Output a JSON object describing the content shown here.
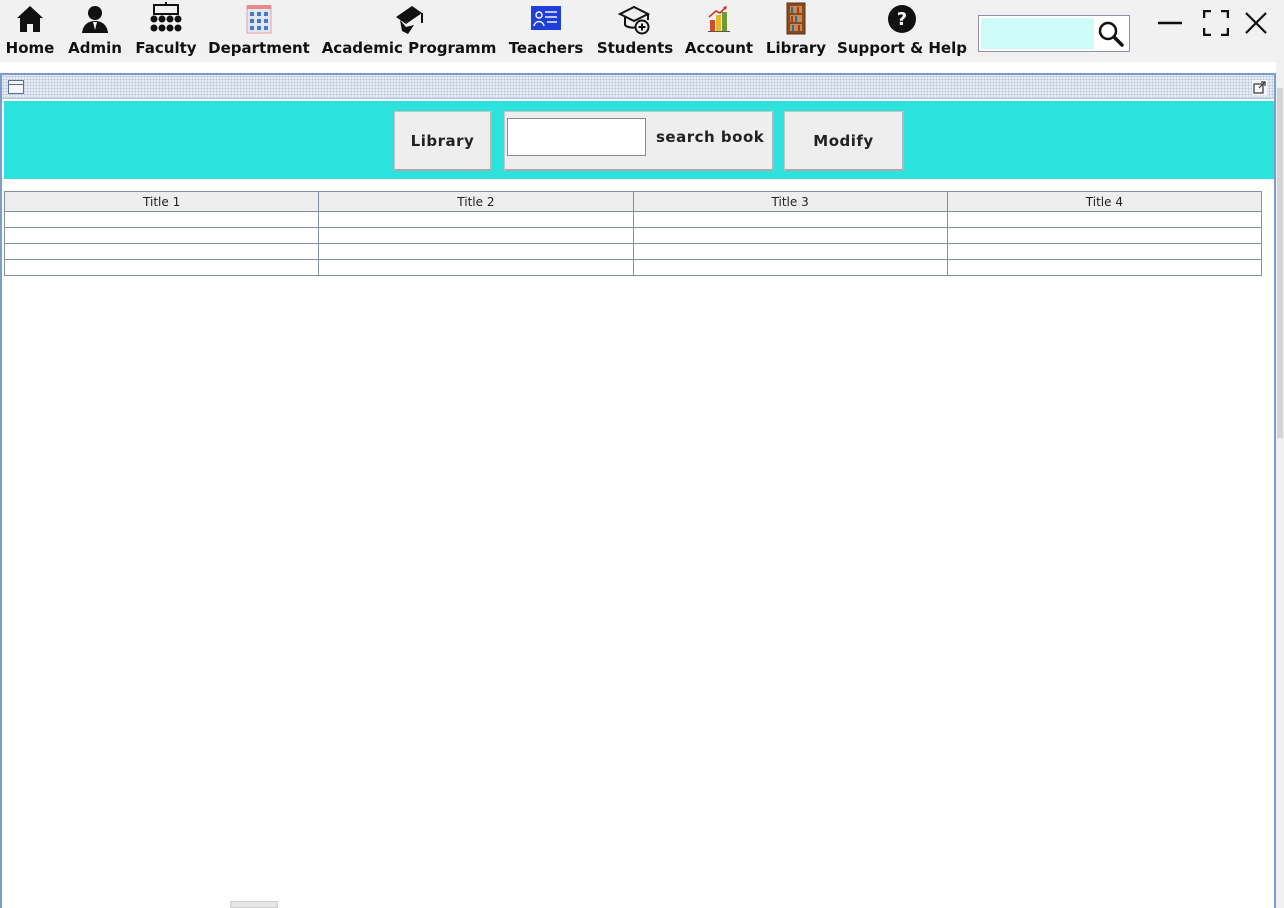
{
  "nav": {
    "items": [
      {
        "label": "Home",
        "icon": "home-icon"
      },
      {
        "label": "Admin",
        "icon": "admin-user-icon"
      },
      {
        "label": "Faculty",
        "icon": "faculty-group-icon"
      },
      {
        "label": "Department",
        "icon": "department-building-icon"
      },
      {
        "label": "Academic Programm",
        "icon": "graduation-cap-icon"
      },
      {
        "label": "Teachers",
        "icon": "teacher-board-icon"
      },
      {
        "label": "Students",
        "icon": "student-cap-add-icon"
      },
      {
        "label": "Account",
        "icon": "account-chart-icon"
      },
      {
        "label": "Library",
        "icon": "bookshelf-icon"
      },
      {
        "label": "Support & Help",
        "icon": "question-icon"
      }
    ]
  },
  "top_search": {
    "value": "",
    "icon": "search-icon"
  },
  "window_controls": {
    "minimize": "minimize-icon",
    "maximize": "maximize-icon",
    "close": "close-icon"
  },
  "toolbar": {
    "library_label": "Library",
    "search_value": "",
    "search_label": "search book",
    "modify_label": "Modify"
  },
  "table": {
    "columns": [
      "Title 1",
      "Title 2",
      "Title 3",
      "Title 4"
    ],
    "rows": [
      [
        "",
        "",
        "",
        ""
      ],
      [
        "",
        "",
        "",
        ""
      ],
      [
        "",
        "",
        "",
        ""
      ],
      [
        "",
        "",
        "",
        ""
      ]
    ]
  },
  "colors": {
    "toolbar_bg": "#2be2dc",
    "top_search_bg": "#cdfcf8",
    "frame_border": "#7a9ed2"
  }
}
